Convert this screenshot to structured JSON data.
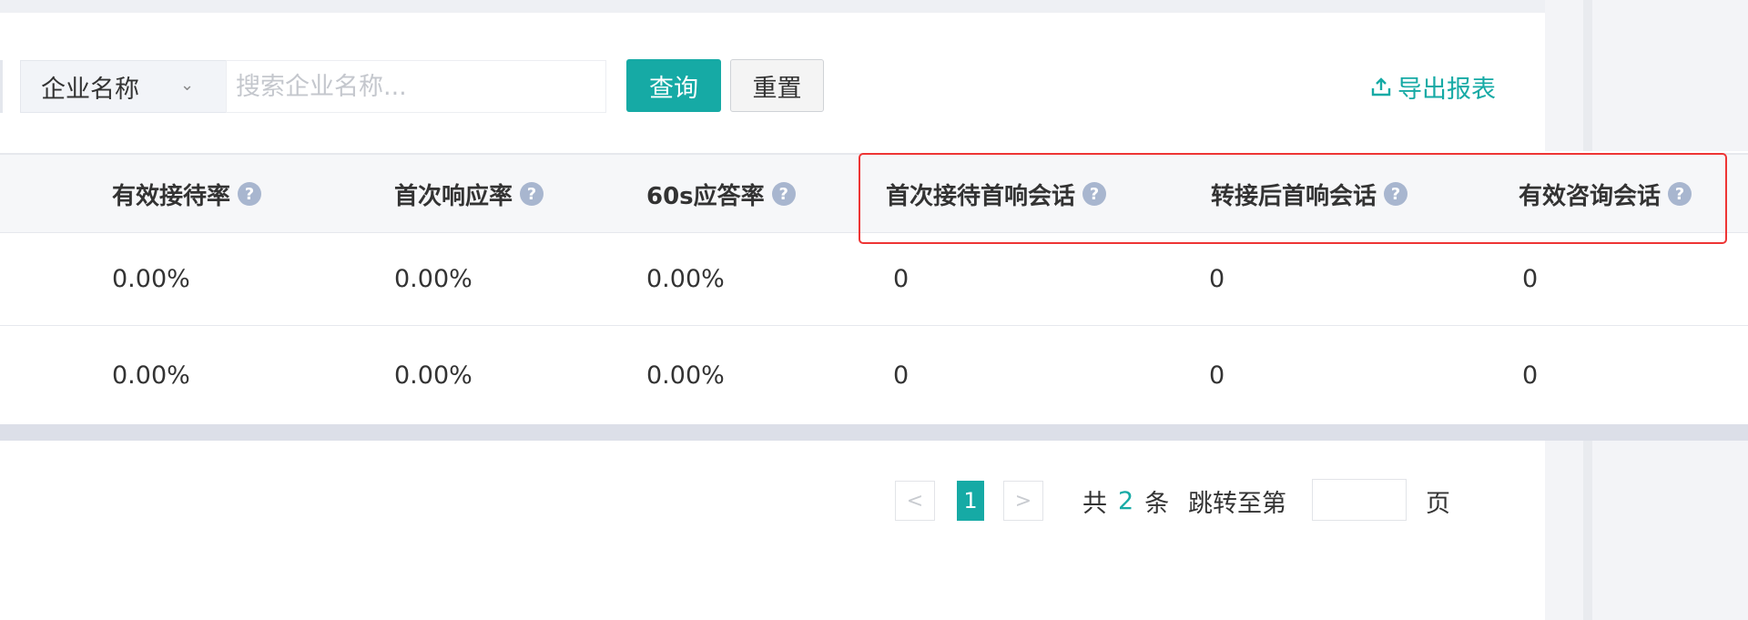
{
  "filter": {
    "field_select": "企业名称",
    "search_placeholder": "搜索企业名称...",
    "query_label": "查询",
    "reset_label": "重置"
  },
  "export": {
    "label": "导出报表",
    "icon": "upload-icon"
  },
  "table": {
    "columns": [
      {
        "label": "有效接待率",
        "help_icon": "question-circle-icon"
      },
      {
        "label": "首次响应率",
        "help_icon": "question-circle-icon"
      },
      {
        "label": "60s应答率",
        "help_icon": "question-circle-icon"
      },
      {
        "label": "首次接待首响会话",
        "help_icon": "question-circle-icon"
      },
      {
        "label": "转接后首响会话",
        "help_icon": "question-circle-icon"
      },
      {
        "label": "有效咨询会话",
        "help_icon": "question-circle-icon"
      }
    ],
    "rows": [
      [
        "0.00%",
        "0.00%",
        "0.00%",
        "0",
        "0",
        "0"
      ],
      [
        "0.00%",
        "0.00%",
        "0.00%",
        "0",
        "0",
        "0"
      ]
    ],
    "highlight_color": "#ee3535"
  },
  "pagination": {
    "prev": "<",
    "current_page": "1",
    "next": ">",
    "total_prefix": "共",
    "total_count": "2",
    "total_suffix": "条",
    "jump_label": "跳转至第",
    "page_suffix": "页"
  },
  "colors": {
    "accent": "#16aaa5"
  }
}
